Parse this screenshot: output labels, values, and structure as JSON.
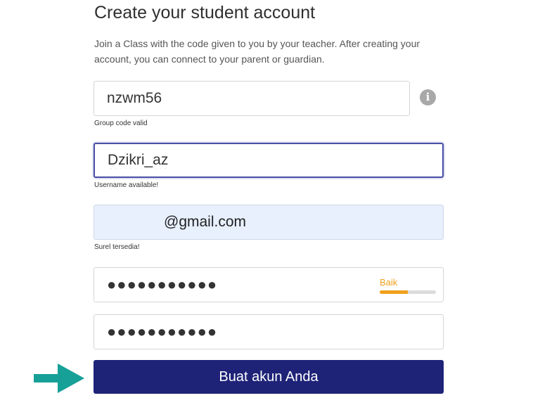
{
  "header": {
    "title": "Create your student account",
    "intro": "Join a Class with the code given to you by your teacher. After creating your account, you can connect to your parent or guardian."
  },
  "form": {
    "group_code": {
      "value": "nzwm56",
      "hint": "Group code valid"
    },
    "info_icon": "i",
    "username": {
      "value": "Dzikri_az",
      "hint": "Username available!"
    },
    "email": {
      "value": "@gmail.com",
      "hint": "Surel tersedia!"
    },
    "password": {
      "value": "●●●●●●●●●●●",
      "strength_label": "Baik",
      "strength_level": 0.5
    },
    "confirm_password": {
      "value": "●●●●●●●●●●●"
    },
    "submit_label": "Buat akun Anda"
  },
  "colors": {
    "primary": "#1e2378",
    "arrow": "#17a097",
    "strength": "#f0a01e",
    "email_bg": "#e8f0fe"
  },
  "icons": {
    "pointer_arrow": "arrow-right-icon",
    "info": "info-icon"
  }
}
